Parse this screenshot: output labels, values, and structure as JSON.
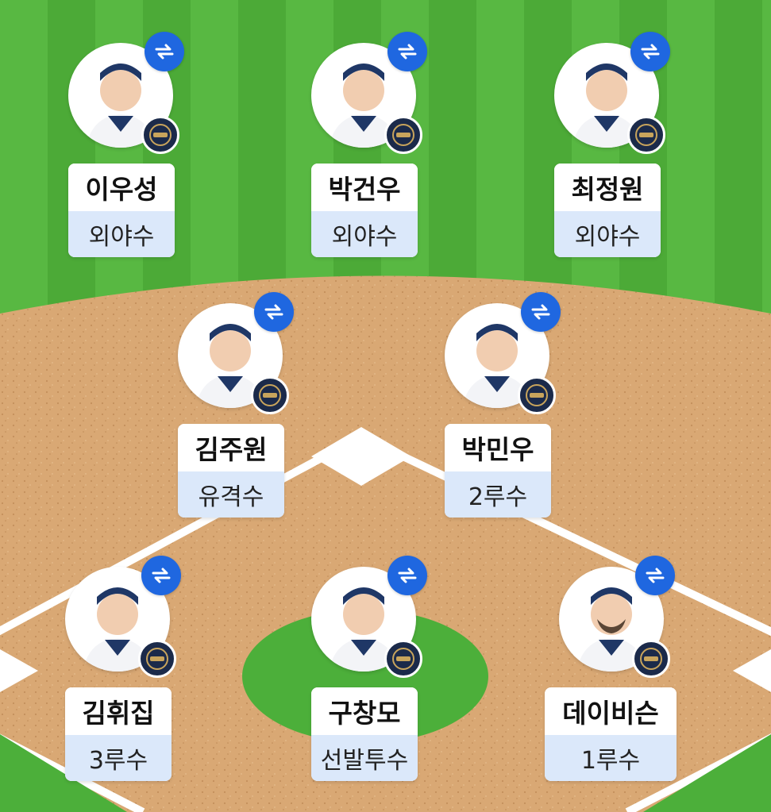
{
  "colors": {
    "grass_light": "#5bbd43",
    "grass_dark": "#49a534",
    "dirt": "#d9a772",
    "base": "#ffffff",
    "swap_button": "#1f67e0",
    "position_bg": "#dbe8fa",
    "team_navy": "#1b2a4a"
  },
  "icons": {
    "swap": "swap-arrows-icon",
    "team_logo": "team-logo-icon",
    "player_photo": "player-photo"
  },
  "players": [
    {
      "name": "이우성",
      "position": "외야수"
    },
    {
      "name": "박건우",
      "position": "외야수"
    },
    {
      "name": "최정원",
      "position": "외야수"
    },
    {
      "name": "김주원",
      "position": "유격수"
    },
    {
      "name": "박민우",
      "position": "2루수"
    },
    {
      "name": "김휘집",
      "position": "3루수"
    },
    {
      "name": "구창모",
      "position": "선발투수"
    },
    {
      "name": "데이비슨",
      "position": "1루수"
    }
  ]
}
